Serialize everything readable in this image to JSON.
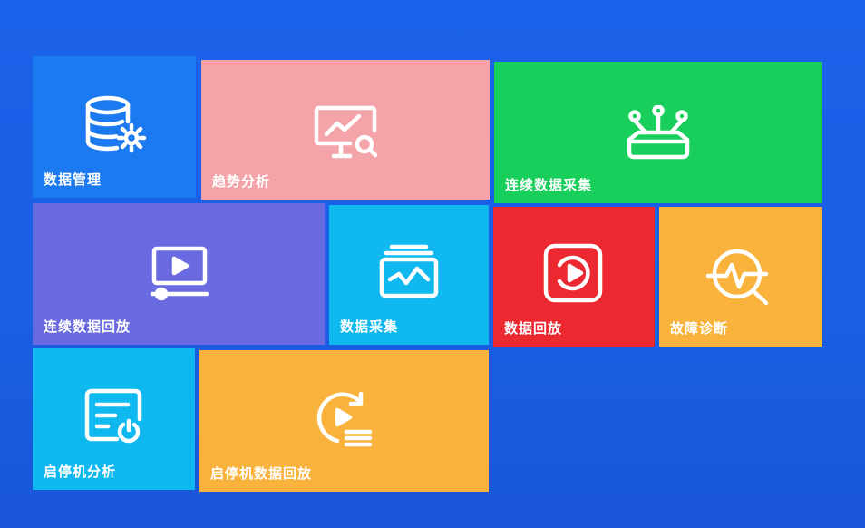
{
  "tiles": [
    {
      "id": "t1",
      "label": "数据管理",
      "color": "#1b7af0",
      "icon": "database-gear-icon"
    },
    {
      "id": "t2",
      "label": "趋势分析",
      "color": "#f4a3a9",
      "icon": "trend-monitor-icon"
    },
    {
      "id": "t3",
      "label": "连续数据采集",
      "color": "#19cf5b",
      "icon": "sensor-hub-icon"
    },
    {
      "id": "t4",
      "label": "连续数据回放",
      "color": "#6a6be0",
      "icon": "video-player-icon"
    },
    {
      "id": "t5",
      "label": "数据采集",
      "color": "#0fb9ef",
      "icon": "waveform-stack-icon"
    },
    {
      "id": "t6",
      "label": "数据回放",
      "color": "#ec2830",
      "icon": "replay-play-icon"
    },
    {
      "id": "t7",
      "label": "故障诊断",
      "color": "#f9b33d",
      "icon": "diagnosis-pulse-icon"
    },
    {
      "id": "t8",
      "label": "启停机分析",
      "color": "#0fb9ef",
      "icon": "report-power-icon"
    },
    {
      "id": "t9",
      "label": "启停机数据回放",
      "color": "#f9b33d",
      "icon": "refresh-play-list-icon"
    }
  ]
}
